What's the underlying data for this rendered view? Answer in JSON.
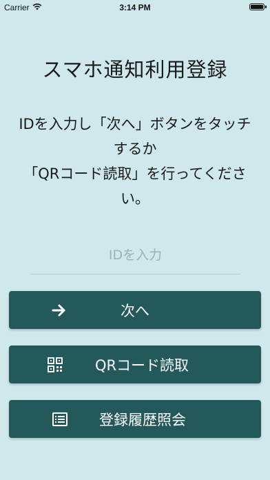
{
  "status_bar": {
    "carrier": "Carrier",
    "time": "3:14 PM",
    "battery_level": 1.0
  },
  "title": "スマホ通知利用登録",
  "instructions": [
    "IDを入力し「次へ」ボタンをタッチ",
    "するか",
    "「QRコード読取」を行ってくださ",
    "い。"
  ],
  "id_input": {
    "placeholder": "IDを入力",
    "value": ""
  },
  "buttons": {
    "next": {
      "label": "次へ",
      "icon": "arrow-right-icon"
    },
    "qr": {
      "label": "QRコード読取",
      "icon": "qr-code-icon"
    },
    "history": {
      "label": "登録履歴照会",
      "icon": "list-icon"
    }
  },
  "colors": {
    "background": "#cfe8eb",
    "button": "#24595b",
    "button_text": "#ffffff"
  }
}
